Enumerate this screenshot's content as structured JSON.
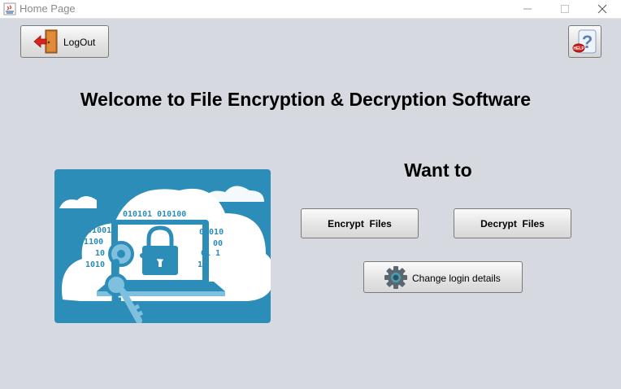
{
  "window": {
    "title": "Home Page",
    "controls": [
      "minimize-icon",
      "maximize-icon",
      "close-icon"
    ]
  },
  "toolbar": {
    "logout_label": "LogOut",
    "logout_icon": "door-exit-icon",
    "help_icon": "help-question-icon"
  },
  "main": {
    "heading": "Welcome to File Encryption & Decryption Software",
    "prompt": "Want to",
    "encrypt_label": "Encrypt  Files",
    "decrypt_label": "Decrypt  Files",
    "change_login_label": "Change login details",
    "change_login_icon": "gear-icon"
  },
  "illustration": {
    "binary_lines": [
      "010101 010100",
      "01010010",
      "0101100",
      "10 0",
      "1010",
      "01010",
      "00",
      "01 1",
      "1"
    ]
  },
  "colors": {
    "background": "#d6d9df",
    "illustration_blue": "#2b8db8",
    "illustration_light": "#7fc0de",
    "logout_arrow": "#d8261f",
    "door": "#c8742b"
  }
}
